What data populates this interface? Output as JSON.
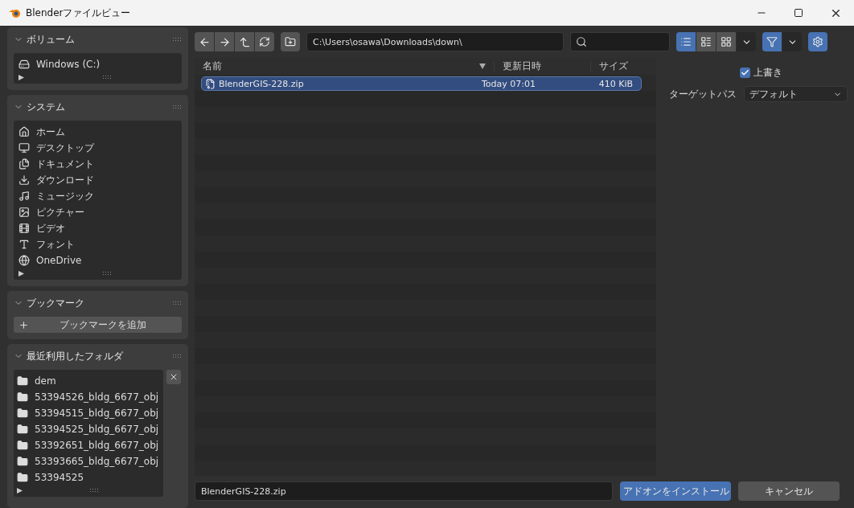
{
  "window": {
    "title": "Blenderファイルビュー"
  },
  "sidebar": {
    "panels": [
      {
        "kind": "list",
        "title": "ボリューム",
        "expanded": true,
        "items": [
          {
            "label": "Windows (C:)"
          }
        ]
      },
      {
        "kind": "list",
        "title": "システム",
        "expanded": true,
        "items": [
          {
            "label": "ホーム"
          },
          {
            "label": "デスクトップ"
          },
          {
            "label": "ドキュメント"
          },
          {
            "label": "ダウンロード"
          },
          {
            "label": "ミュージック"
          },
          {
            "label": "ピクチャー"
          },
          {
            "label": "ビデオ"
          },
          {
            "label": "フォント"
          },
          {
            "label": "OneDrive"
          }
        ]
      },
      {
        "kind": "button",
        "title": "ブックマーク",
        "expanded": true,
        "button": "ブックマークを追加"
      },
      {
        "kind": "list",
        "title": "最近利用したフォルダ",
        "expanded": true,
        "clearable": true,
        "items": [
          {
            "label": "dem"
          },
          {
            "label": "53394526_bldg_6677_obj"
          },
          {
            "label": "53394515_bldg_6677_obj"
          },
          {
            "label": "53394525_bldg_6677_obj"
          },
          {
            "label": "53392651_bldg_6677_obj"
          },
          {
            "label": "53393665_bldg_6677_obj"
          },
          {
            "label": "53394525"
          }
        ]
      }
    ]
  },
  "toolbar": {
    "path": "C:\\Users\\osawa\\Downloads\\down\\",
    "view_modes": [
      {
        "selected": true
      },
      {
        "selected": false
      },
      {
        "selected": false
      }
    ],
    "filter_on": true
  },
  "table": {
    "columns": [
      "名前",
      "更新日時",
      "サイズ"
    ],
    "rows": [
      {
        "name": "BlenderGIS-228.zip",
        "date": "Today 07:01",
        "size": "410 KiB",
        "selected": true
      }
    ]
  },
  "options": {
    "overwrite": {
      "label": "上書き",
      "checked": true
    },
    "target_path": {
      "label": "ターゲットパス",
      "value": "デフォルト"
    }
  },
  "bottom": {
    "filename": "BlenderGIS-228.zip",
    "confirm": "アドオンをインストール",
    "cancel": "キャンセル"
  }
}
